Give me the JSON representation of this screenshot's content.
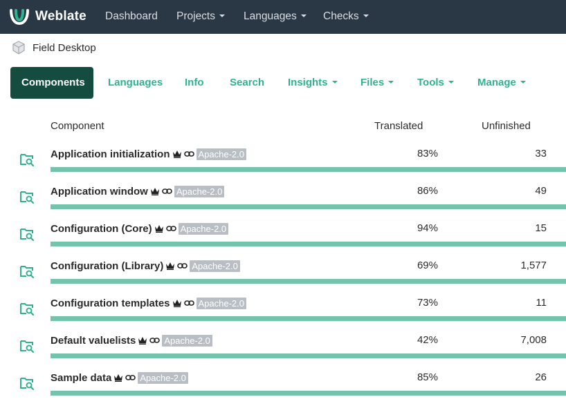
{
  "navbar": {
    "brand": "Weblate",
    "items": [
      {
        "label": "Dashboard",
        "dropdown": false
      },
      {
        "label": "Projects",
        "dropdown": true
      },
      {
        "label": "Languages",
        "dropdown": true
      },
      {
        "label": "Checks",
        "dropdown": true
      }
    ]
  },
  "breadcrumb": {
    "project": "Field Desktop",
    "icon": "cube-icon"
  },
  "tabs": [
    {
      "label": "Components",
      "active": true
    },
    {
      "label": "Languages"
    },
    {
      "label": "Info"
    },
    {
      "label": "Search"
    },
    {
      "label": "Insights",
      "dropdown": true
    },
    {
      "label": "Files",
      "dropdown": true
    },
    {
      "label": "Tools",
      "dropdown": true
    },
    {
      "label": "Manage",
      "dropdown": true
    }
  ],
  "table": {
    "headers": {
      "component": "Component",
      "translated": "Translated",
      "unfinished": "Unfinished"
    },
    "rows": [
      {
        "name": "Application initialization",
        "license": "Apache-2.0",
        "translated": "83%",
        "translated_fraction": 1.0,
        "unfinished": "33"
      },
      {
        "name": "Application window",
        "license": "Apache-2.0",
        "translated": "86%",
        "translated_fraction": 1.0,
        "unfinished": "49"
      },
      {
        "name": "Configuration (Core)",
        "license": "Apache-2.0",
        "translated": "94%",
        "translated_fraction": 1.0,
        "unfinished": "15"
      },
      {
        "name": "Configuration (Library)",
        "license": "Apache-2.0",
        "translated": "69%",
        "translated_fraction": 1.0,
        "unfinished": "1,577"
      },
      {
        "name": "Configuration templates",
        "license": "Apache-2.0",
        "translated": "73%",
        "translated_fraction": 1.0,
        "unfinished": "11"
      },
      {
        "name": "Default valuelists",
        "license": "Apache-2.0",
        "translated": "42%",
        "translated_fraction": 1.0,
        "unfinished": "7,008"
      },
      {
        "name": "Sample data",
        "license": "Apache-2.0",
        "translated": "85%",
        "translated_fraction": 1.0,
        "unfinished": "26"
      }
    ]
  },
  "colors": {
    "navbar_bg": "#2a3744",
    "accent": "#2eb391",
    "active_tab_bg": "#144d3f",
    "progress_fill": "#74c3ad",
    "license_badge": "#b8bec4"
  }
}
